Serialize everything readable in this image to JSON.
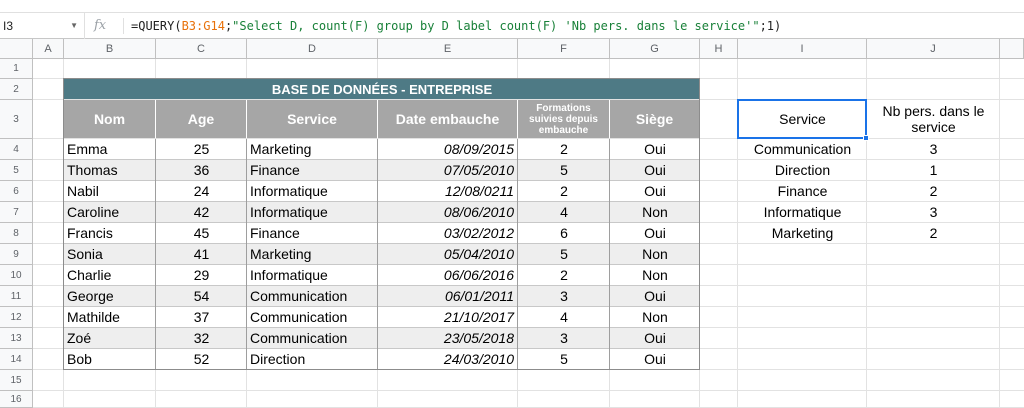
{
  "formula_bar": {
    "cell_ref": "I3",
    "fx": "fx",
    "formula_prefix": "=QUERY(",
    "formula_range": "B3:G14",
    "formula_sep": ";",
    "formula_string": "\"Select D, count(F) group by D label count(F) 'Nb pers. dans le service'\"",
    "formula_suffix": ";1)"
  },
  "columns": [
    "A",
    "B",
    "C",
    "D",
    "E",
    "F",
    "G",
    "H",
    "I",
    "J"
  ],
  "rows": [
    "1",
    "2",
    "3",
    "4",
    "5",
    "6",
    "7",
    "8",
    "9",
    "10",
    "11",
    "12",
    "13",
    "14",
    "15",
    "16"
  ],
  "table": {
    "title": "BASE DE DONNÉES - ENTREPRISE",
    "headers": [
      "Nom",
      "Age",
      "Service",
      "Date embauche",
      "Formations suivies depuis embauche",
      "Siège"
    ],
    "rows": [
      [
        "Emma",
        "25",
        "Marketing",
        "08/09/2015",
        "2",
        "Oui"
      ],
      [
        "Thomas",
        "36",
        "Finance",
        "07/05/2010",
        "5",
        "Oui"
      ],
      [
        "Nabil",
        "24",
        "Informatique",
        "12/08/0211",
        "2",
        "Oui"
      ],
      [
        "Caroline",
        "42",
        "Informatique",
        "08/06/2010",
        "4",
        "Non"
      ],
      [
        "Francis",
        "45",
        "Finance",
        "03/02/2012",
        "6",
        "Oui"
      ],
      [
        "Sonia",
        "41",
        "Marketing",
        "05/04/2010",
        "5",
        "Non"
      ],
      [
        "Charlie",
        "29",
        "Informatique",
        "06/06/2016",
        "2",
        "Non"
      ],
      [
        "George",
        "54",
        "Communication",
        "06/01/2011",
        "3",
        "Oui"
      ],
      [
        "Mathilde",
        "37",
        "Communication",
        "21/10/2017",
        "4",
        "Non"
      ],
      [
        "Zoé",
        "32",
        "Communication",
        "23/05/2018",
        "3",
        "Oui"
      ],
      [
        "Bob",
        "52",
        "Direction",
        "24/03/2010",
        "5",
        "Oui"
      ]
    ]
  },
  "query_result": {
    "headers": [
      "Service",
      "Nb pers. dans le service"
    ],
    "rows": [
      [
        "Communication",
        "3"
      ],
      [
        "Direction",
        "1"
      ],
      [
        "Finance",
        "2"
      ],
      [
        "Informatique",
        "3"
      ],
      [
        "Marketing",
        "2"
      ]
    ]
  },
  "colors": {
    "banner": "#4e7a85",
    "header": "#a6a6a6",
    "band": "#eeeeee",
    "selection": "#1a73e8",
    "range_ref": "#e8710a",
    "string_literal": "#188038"
  }
}
